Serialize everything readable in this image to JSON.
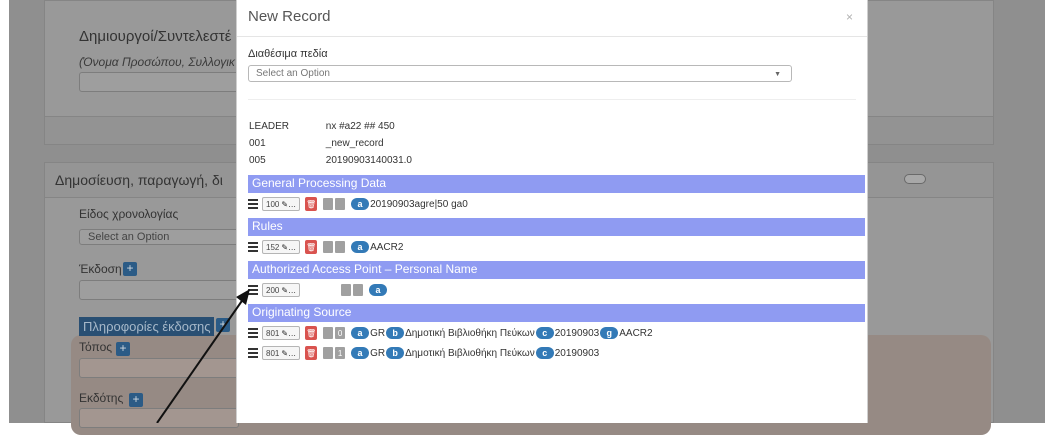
{
  "background": {
    "creators_title": "Δημιουργοί/Συντελεστέ",
    "creators_hint": "(Όνομα Προσώπου, Συλλογικ",
    "publication_title": "Δημοσίευση, παραγωγή, δι",
    "date_type_label": "Είδος χρονολογίας",
    "date_type_select": "Select an Option",
    "edition_label": "Έκδοση",
    "pub_info_label": "Πληροφορίες έκδοσης",
    "place_label": "Τόπος",
    "publisher_label": "Εκδότης",
    "plus": "+"
  },
  "modal": {
    "title": "New Record",
    "close": "×",
    "available_fields_label": "Διαθέσιμα πεδία",
    "select_placeholder": "Select an Option",
    "caret": "▼",
    "control_fields": [
      {
        "tag": "LEADER",
        "value": "nx #a22 ## 450"
      },
      {
        "tag": "001",
        "value": "_new_record"
      },
      {
        "tag": "005",
        "value": "20190903140031.0"
      }
    ],
    "sections": [
      {
        "title": "General Processing Data",
        "fields": [
          {
            "tag": "100",
            "ind1": "",
            "ind2": "",
            "subfields": [
              {
                "code": "a",
                "value": "20190903agre|50 ga0"
              }
            ]
          }
        ]
      },
      {
        "title": "Rules",
        "fields": [
          {
            "tag": "152",
            "ind1": "",
            "ind2": "",
            "subfields": [
              {
                "code": "a",
                "value": "AACR2"
              }
            ]
          }
        ]
      },
      {
        "title": "Authorized Access Point – Personal Name",
        "fields": [
          {
            "tag": "200",
            "ind1": "",
            "ind2": "",
            "subfields": [
              {
                "code": "a",
                "value": ""
              }
            ]
          }
        ]
      },
      {
        "title": "Originating Source",
        "fields": [
          {
            "tag": "801",
            "ind1": "",
            "ind2": "0",
            "subfields": [
              {
                "code": "a",
                "value": "GR"
              },
              {
                "code": "b",
                "value": "Δημοτική Βιβλιοθήκη Πεύκων"
              },
              {
                "code": "c",
                "value": "20190903"
              },
              {
                "code": "g",
                "value": "AACR2"
              }
            ]
          },
          {
            "tag": "801",
            "ind1": "",
            "ind2": "1",
            "subfields": [
              {
                "code": "a",
                "value": "GR"
              },
              {
                "code": "b",
                "value": "Δημοτική Βιβλιοθήκη Πεύκων"
              },
              {
                "code": "c",
                "value": "20190903"
              }
            ]
          }
        ]
      }
    ]
  }
}
